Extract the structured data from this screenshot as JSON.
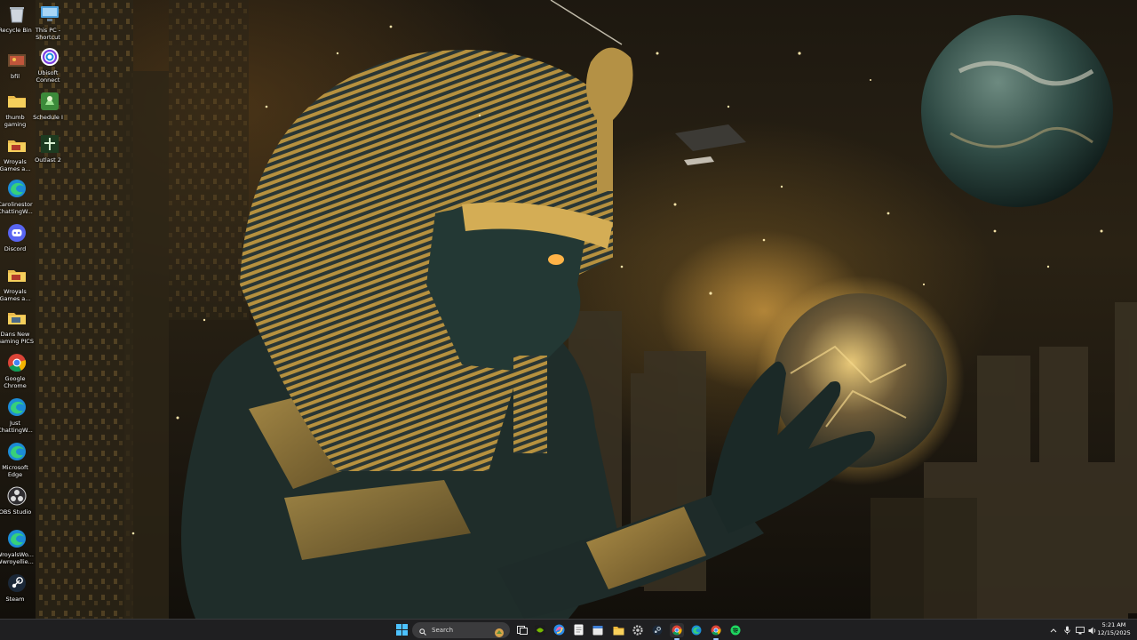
{
  "desktop": {
    "icons": [
      {
        "label": "Recycle Bin",
        "icon": "recycle-bin-icon"
      },
      {
        "label": "bfil",
        "icon": "folder-image-icon"
      },
      {
        "label": "thumb gaming",
        "icon": "folder-icon"
      },
      {
        "label": "Wroyals Games a...",
        "icon": "folder-icon"
      },
      {
        "label": "Carolinestor ChattingW...",
        "icon": "edge-icon"
      },
      {
        "label": "Discord",
        "icon": "discord-icon"
      },
      {
        "label": "Wroyals Games a...",
        "icon": "folder-icon"
      },
      {
        "label": "Dans New Gaming PICS",
        "icon": "folder-icon"
      },
      {
        "label": "Google Chrome",
        "icon": "chrome-icon"
      },
      {
        "label": "Just ChattingW...",
        "icon": "edge-icon"
      },
      {
        "label": "Microsoft Edge",
        "icon": "edge-icon"
      },
      {
        "label": "OBS Studio",
        "icon": "obs-icon"
      },
      {
        "label": "WroyalsWo... Wwroyellie...",
        "icon": "edge-icon"
      },
      {
        "label": "Steam",
        "icon": "steam-icon"
      },
      {
        "label": "This PC - Shortcut",
        "icon": "monitor-icon"
      },
      {
        "label": "Ubisoft Connect",
        "icon": "ubisoft-icon"
      },
      {
        "label": "Schedule I",
        "icon": "schedule-game-icon"
      },
      {
        "label": "Outlast 2",
        "icon": "outlast-icon"
      }
    ]
  },
  "taskbar": {
    "search_placeholder": "Search",
    "pinned": [
      "windows-start-icon",
      "task-view-icon",
      "nvidia-icon",
      "copilot-icon",
      "notepad-icon",
      "calendar-icon",
      "file-explorer-icon",
      "settings-icon",
      "steam-icon",
      "chrome-icon",
      "edge-icon",
      "chrome-alt-icon",
      "spotify-icon"
    ],
    "tray_icons": [
      "chevron-up-icon",
      "microphone-icon",
      "network-icon",
      "volume-icon"
    ],
    "clock": {
      "time": "5:21 AM",
      "date": "12/15/2025"
    }
  },
  "colors": {
    "taskbar_bg": "#202022",
    "accent": "#9ccaff"
  }
}
